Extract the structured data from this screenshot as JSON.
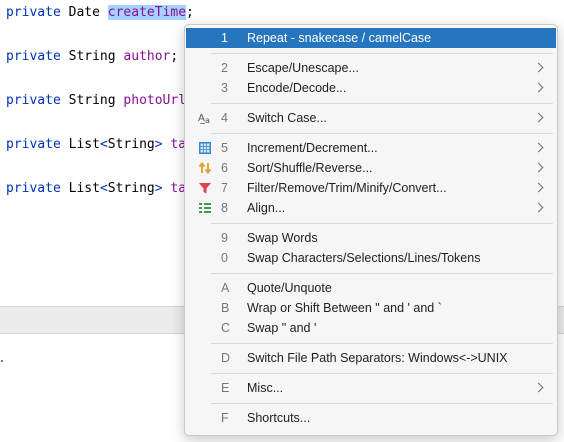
{
  "editor": {
    "lines": [
      {
        "kw": "private",
        "type": "Date",
        "field": "createTime",
        "suffix": ";"
      },
      {
        "kw": "private",
        "type": "String",
        "field": "author",
        "suffix": ";"
      },
      {
        "kw": "private",
        "type": "String",
        "field": "photoUrl",
        "suffix": ""
      },
      {
        "kw": "private",
        "type": "List",
        "generic": "String",
        "field": "ta",
        "suffix": ""
      },
      {
        "kw": "private",
        "type": "List",
        "generic": "String",
        "field": "ta",
        "suffix": ""
      }
    ]
  },
  "menu": {
    "items": [
      {
        "mnemonic": "1",
        "label": "Repeat - snakecase / camelCase",
        "icon": "",
        "submenu": false,
        "active": true
      },
      {
        "mnemonic": "2",
        "label": "Escape/Unescape...",
        "icon": "",
        "submenu": true
      },
      {
        "mnemonic": "3",
        "label": "Encode/Decode...",
        "icon": "",
        "submenu": true
      },
      {
        "mnemonic": "4",
        "label": "Switch Case...",
        "icon": "text-case-icon",
        "submenu": true
      },
      {
        "mnemonic": "5",
        "label": "Increment/Decrement...",
        "icon": "calculator-icon",
        "submenu": true
      },
      {
        "mnemonic": "6",
        "label": "Sort/Shuffle/Reverse...",
        "icon": "sort-arrows-icon",
        "submenu": true
      },
      {
        "mnemonic": "7",
        "label": "Filter/Remove/Trim/Minify/Convert...",
        "icon": "filter-icon",
        "submenu": true
      },
      {
        "mnemonic": "8",
        "label": "Align...",
        "icon": "align-icon",
        "submenu": true
      },
      {
        "mnemonic": "9",
        "label": "Swap Words",
        "icon": "",
        "submenu": false
      },
      {
        "mnemonic": "0",
        "label": "Swap Characters/Selections/Lines/Tokens",
        "icon": "",
        "submenu": false
      },
      {
        "mnemonic": "A",
        "label": "Quote/Unquote",
        "icon": "",
        "submenu": false
      },
      {
        "mnemonic": "B",
        "label": "Wrap or Shift Between \" and ' and `",
        "icon": "",
        "submenu": false
      },
      {
        "mnemonic": "C",
        "label": "Swap \" and '",
        "icon": "",
        "submenu": false
      },
      {
        "mnemonic": "D",
        "label": "Switch File Path Separators: Windows<->UNIX",
        "icon": "",
        "submenu": false
      },
      {
        "mnemonic": "E",
        "label": "Misc...",
        "icon": "",
        "submenu": true
      },
      {
        "mnemonic": "F",
        "label": "Shortcuts...",
        "icon": "",
        "submenu": false
      }
    ]
  },
  "colors": {
    "selection_bg": "#2675bf",
    "keyword": "#0033b3",
    "field": "#871094",
    "text_highlight": "#a6d2ff"
  }
}
